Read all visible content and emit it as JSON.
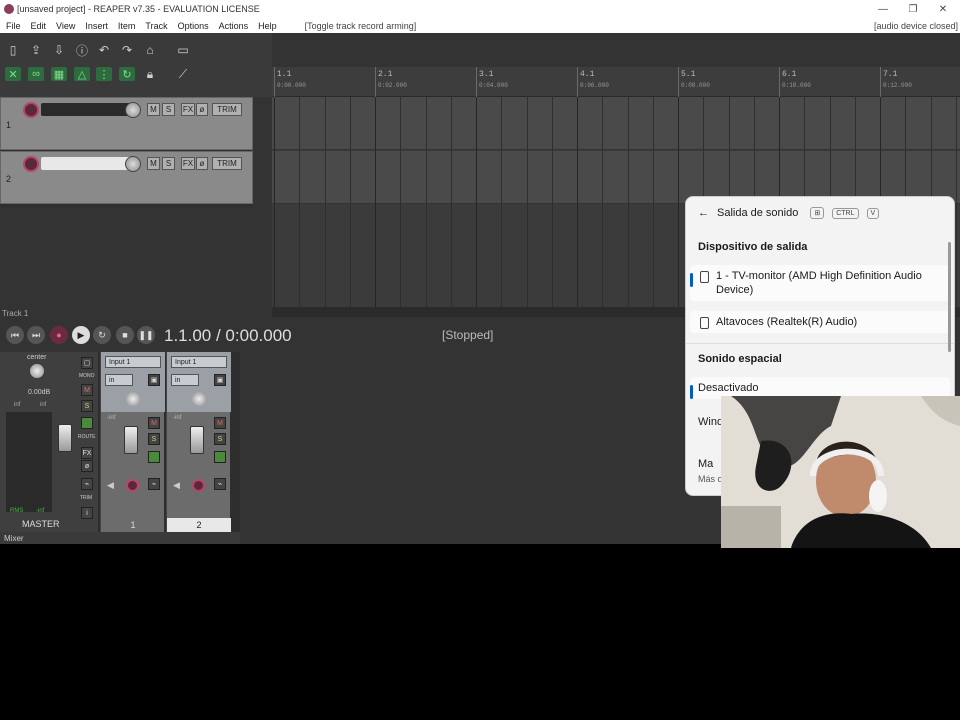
{
  "window": {
    "title": "[unsaved project] - REAPER v7.35 - EVALUATION LICENSE",
    "min": "—",
    "max": "❐",
    "close": "✕"
  },
  "menu": {
    "items": [
      "File",
      "Edit",
      "View",
      "Insert",
      "Item",
      "Track",
      "Options",
      "Actions",
      "Help"
    ],
    "hint": "[Toggle track record arming]",
    "status": "[audio device closed]"
  },
  "ruler": {
    "marks": [
      {
        "m": "1.1",
        "t": "0:00.000"
      },
      {
        "m": "2.1",
        "t": "0:02.000"
      },
      {
        "m": "3.1",
        "t": "0:04.000"
      },
      {
        "m": "4.1",
        "t": "0:06.000"
      },
      {
        "m": "5.1",
        "t": "0:08.000"
      },
      {
        "m": "6.1",
        "t": "0:10.000"
      },
      {
        "m": "7.1",
        "t": "0:12.000"
      }
    ]
  },
  "tracks": [
    {
      "number": "1"
    },
    {
      "number": "2"
    }
  ],
  "trackButtons": {
    "mute": "M",
    "solo": "S",
    "fx": "FX",
    "trim": "TRIM"
  },
  "trackLabel": "Track 1",
  "transport": {
    "time": "1.1.00 / 0:00.000",
    "state": "[Stopped]"
  },
  "master": {
    "pan": "center",
    "vol": "0.00dB",
    "peakL": "inf",
    "peakR": "inf",
    "rms": "RMS",
    "rmsVal": "-inf",
    "label": "MASTER",
    "mono": "MONO",
    "route": "ROUTE",
    "trim": "TRIM",
    "fx": "FX",
    "info": "i"
  },
  "channels": [
    {
      "input": "Input 1",
      "in": "in",
      "inf": "-inf",
      "num": "1"
    },
    {
      "input": "Input 1",
      "in": "in",
      "inf": "-inf",
      "num": "2"
    }
  ],
  "mixerTab": "Mixer",
  "sound": {
    "title": "Salida de sonido",
    "keyCtrl": "CTRL",
    "keyV": "V",
    "section1": "Dispositivo de salida",
    "device1": "1 - TV-monitor (AMD High Definition Audio Device)",
    "device2": "Altavoces (Realtek(R) Audio)",
    "section2": "Sonido espacial",
    "spatial": "Desactivado",
    "item3": "Wind",
    "item4": "Ma",
    "more": "Más o"
  },
  "colors": {
    "accent": "#005fb8",
    "record": "#b8446a"
  }
}
